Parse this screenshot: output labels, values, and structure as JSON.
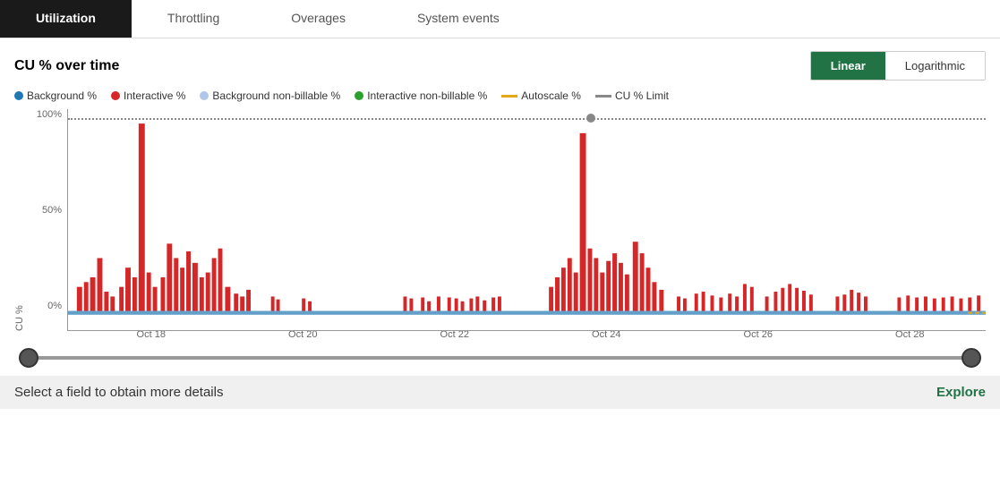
{
  "tabs": [
    {
      "label": "Utilization",
      "active": true
    },
    {
      "label": "Throttling",
      "active": false
    },
    {
      "label": "Overages",
      "active": false
    },
    {
      "label": "System events",
      "active": false
    }
  ],
  "chart": {
    "title": "CU % over time",
    "scale_buttons": [
      {
        "label": "Linear",
        "active": true
      },
      {
        "label": "Logarithmic",
        "active": false
      }
    ],
    "legend": [
      {
        "label": "Background %",
        "color": "#1f77b4",
        "type": "dot"
      },
      {
        "label": "Interactive %",
        "color": "#d62728",
        "type": "dot"
      },
      {
        "label": "Background non-billable %",
        "color": "#aec7e8",
        "type": "dot"
      },
      {
        "label": "Interactive non-billable %",
        "color": "#2ca02c",
        "type": "dot"
      },
      {
        "label": "Autoscale %",
        "color": "#e6a817",
        "type": "line"
      },
      {
        "label": "CU % Limit",
        "color": "#888888",
        "type": "line"
      }
    ],
    "y_axis": {
      "label": "CU %",
      "ticks": [
        "100%",
        "50%",
        "0%"
      ]
    },
    "x_axis": {
      "ticks": [
        "Oct 18",
        "Oct 20",
        "Oct 22",
        "Oct 24",
        "Oct 26",
        "Oct 28"
      ]
    }
  },
  "bottom": {
    "message": "Select a field to obtain more details",
    "explore_label": "Explore"
  }
}
